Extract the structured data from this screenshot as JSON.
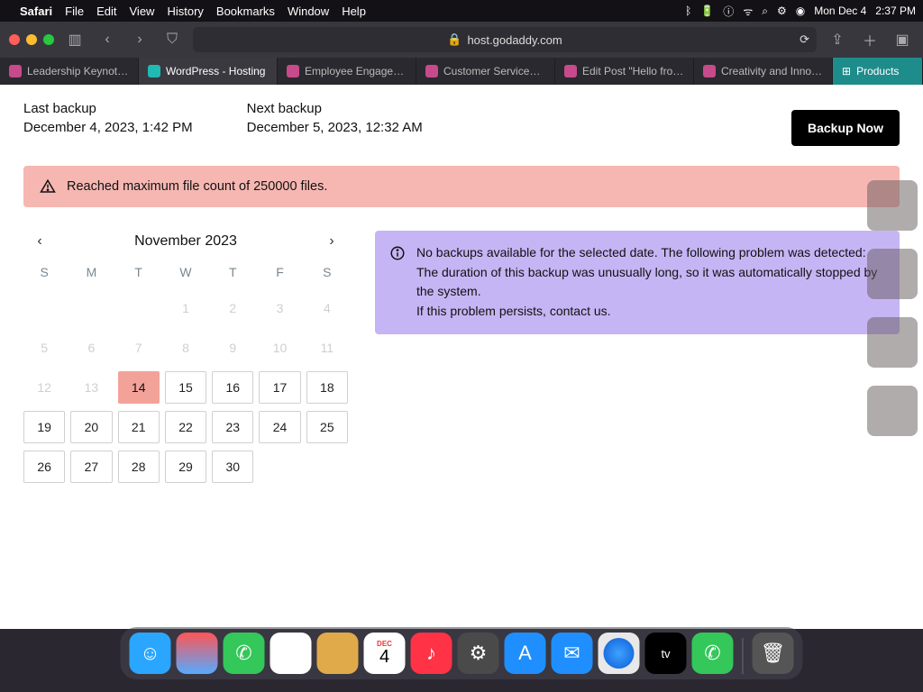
{
  "menubar": {
    "apple": "",
    "app": "Safari",
    "items": [
      "File",
      "Edit",
      "View",
      "History",
      "Bookmarks",
      "Window",
      "Help"
    ],
    "status": {
      "date": "Mon Dec 4",
      "time": "2:37 PM"
    }
  },
  "safari": {
    "url_host": "host.godaddy.com",
    "tabs": [
      {
        "label": "Leadership Keynot…"
      },
      {
        "label": "WordPress - Hosting",
        "active": true
      },
      {
        "label": "Employee Engage…"
      },
      {
        "label": "Customer Service…"
      },
      {
        "label": "Edit Post \"Hello fro…"
      },
      {
        "label": "Creativity and Inno…"
      }
    ],
    "products_tab": "Products"
  },
  "backup": {
    "last_label": "Last backup",
    "last_value": "December 4, 2023, 1:42 PM",
    "next_label": "Next backup",
    "next_value": "December 5, 2023, 12:32 AM",
    "button": "Backup Now"
  },
  "error_alert": "Reached maximum file count of 250000 files.",
  "calendar": {
    "title": "November 2023",
    "dow": [
      "S",
      "M",
      "T",
      "W",
      "T",
      "F",
      "S"
    ],
    "pad": 3,
    "first_faded_end": 13,
    "selected": 14,
    "days": 30
  },
  "info_lines": [
    "No backups available for the selected date. The following problem was detected:",
    "The duration of this backup was unusually long, so it was automatically stopped by the system.",
    "If this problem persists, contact us."
  ],
  "dock": [
    {
      "name": "finder",
      "bg": "#2aa6ff"
    },
    {
      "name": "launchpad",
      "bg": "linear-gradient(#f55,#5af)"
    },
    {
      "name": "messages",
      "bg": "#34c759"
    },
    {
      "name": "photos",
      "bg": "#fff"
    },
    {
      "name": "keynote",
      "bg": "#e0a94a"
    },
    {
      "name": "calendar",
      "bg": "#fff",
      "text": "4",
      "badge": "DEC"
    },
    {
      "name": "music",
      "bg": "#ff3246"
    },
    {
      "name": "settings",
      "bg": "#4a4a4a"
    },
    {
      "name": "appstore",
      "bg": "#1f8fff"
    },
    {
      "name": "mail",
      "bg": "#1f8fff"
    },
    {
      "name": "safari",
      "bg": "#e8e8e8"
    },
    {
      "name": "tv",
      "bg": "#000"
    },
    {
      "name": "facetime",
      "bg": "#34c759"
    }
  ]
}
